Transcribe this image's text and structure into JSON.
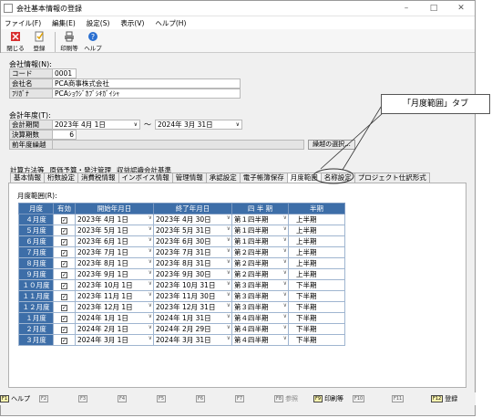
{
  "window": {
    "title": "会社基本情報の登録"
  },
  "menu": [
    "ファイル(F)",
    "編集(E)",
    "設定(S)",
    "表示(V)",
    "ヘルプ(H)"
  ],
  "toolbar": {
    "close": "閉じる",
    "register": "登録",
    "print": "印刷等",
    "help": "ヘルプ"
  },
  "company": {
    "section": "会社情報(N):",
    "code_label": "コード",
    "code": "0001",
    "name_label": "会社名",
    "name": "PCA商事株式会社",
    "kana_label": "ﾌﾘｶﾞﾅ",
    "kana": "PCAｼｮｳｼﾞｶﾌﾞｼｷｶﾞｲｼｬ"
  },
  "fiscal": {
    "section": "会計年度(T):",
    "period_label": "会計期間",
    "start": "2023年  4月  1日",
    "tilde": "～",
    "end": "2024年  3月 31日",
    "count_label": "決算期数",
    "count": "6",
    "prev_label": "前年度繰越",
    "prev_button": "繰越の選択..."
  },
  "tabs_row1": [
    "計算方法等",
    "原価予算・発注管理",
    "収益認識会計基準"
  ],
  "tabs_row2": [
    "基本情報",
    "桁数設定",
    "消費税情報",
    "インボイス情報",
    "管理情報",
    "承認設定",
    "電子帳簿保存",
    "月度範囲",
    "名称設定",
    "プロジェクト仕訳形式"
  ],
  "callout": "「月度範囲」タブ",
  "panel": {
    "title": "月度範囲(R):",
    "headers": [
      "月度",
      "有効",
      "開始年月日",
      "終了年月日",
      "四 半 期",
      "半期"
    ],
    "rows": [
      {
        "m": "４月度",
        "s": "2023年  4月  1日",
        "e": "2023年  4月 30日",
        "q": "第１四半期",
        "h": "上半期"
      },
      {
        "m": "５月度",
        "s": "2023年  5月  1日",
        "e": "2023年  5月 31日",
        "q": "第１四半期",
        "h": "上半期"
      },
      {
        "m": "６月度",
        "s": "2023年  6月  1日",
        "e": "2023年  6月 30日",
        "q": "第１四半期",
        "h": "上半期"
      },
      {
        "m": "７月度",
        "s": "2023年  7月  1日",
        "e": "2023年  7月 31日",
        "q": "第２四半期",
        "h": "上半期"
      },
      {
        "m": "８月度",
        "s": "2023年  8月  1日",
        "e": "2023年  8月 31日",
        "q": "第２四半期",
        "h": "上半期"
      },
      {
        "m": "９月度",
        "s": "2023年  9月  1日",
        "e": "2023年  9月 30日",
        "q": "第２四半期",
        "h": "上半期"
      },
      {
        "m": "１０月度",
        "s": "2023年 10月  1日",
        "e": "2023年 10月 31日",
        "q": "第３四半期",
        "h": "下半期"
      },
      {
        "m": "１１月度",
        "s": "2023年 11月  1日",
        "e": "2023年 11月 30日",
        "q": "第３四半期",
        "h": "下半期"
      },
      {
        "m": "１２月度",
        "s": "2023年 12月  1日",
        "e": "2023年 12月 31日",
        "q": "第３四半期",
        "h": "下半期"
      },
      {
        "m": "１月度",
        "s": "2024年  1月  1日",
        "e": "2024年  1月 31日",
        "q": "第４四半期",
        "h": "下半期"
      },
      {
        "m": "２月度",
        "s": "2024年  2月  1日",
        "e": "2024年  2月 29日",
        "q": "第４四半期",
        "h": "下半期"
      },
      {
        "m": "３月度",
        "s": "2024年  3月  1日",
        "e": "2024年  3月 31日",
        "q": "第４四半期",
        "h": "下半期"
      }
    ]
  },
  "fkeys": [
    {
      "key": "F1",
      "label": "ヘルプ",
      "on": true
    },
    {
      "key": "F2",
      "label": "",
      "on": false
    },
    {
      "key": "F3",
      "label": "",
      "on": false
    },
    {
      "key": "F4",
      "label": "",
      "on": false
    },
    {
      "key": "F5",
      "label": "",
      "on": false
    },
    {
      "key": "F6",
      "label": "",
      "on": false
    },
    {
      "key": "F7",
      "label": "",
      "on": false
    },
    {
      "key": "F8",
      "label": "参照",
      "on": false
    },
    {
      "key": "F9",
      "label": "印刷等",
      "on": true
    },
    {
      "key": "F10",
      "label": "",
      "on": false
    },
    {
      "key": "F11",
      "label": "",
      "on": false
    },
    {
      "key": "F12",
      "label": "登録",
      "on": true
    }
  ]
}
